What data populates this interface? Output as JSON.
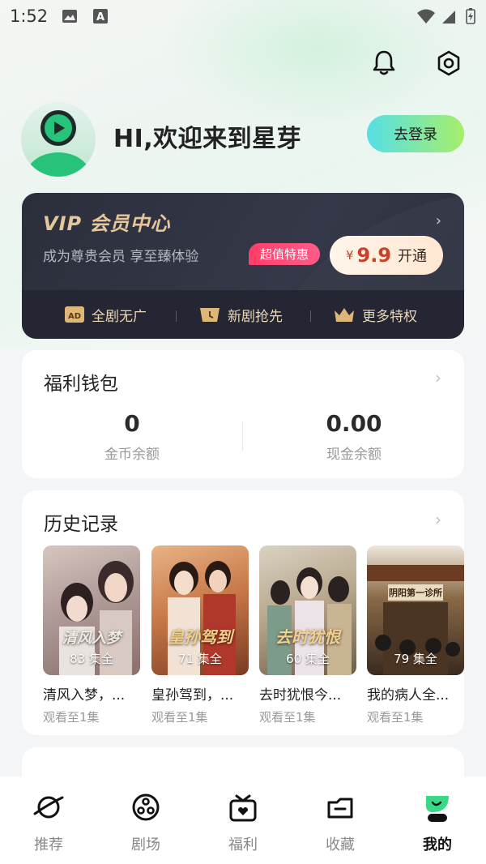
{
  "status_bar": {
    "time": "1:52"
  },
  "header": {
    "greeting": "HI,欢迎来到星芽",
    "login_label": "去登录"
  },
  "vip": {
    "title": "VIP 会员中心",
    "subtitle": "成为尊贵会员 享至臻体验",
    "badge": "超值特惠",
    "price_currency": "¥",
    "price": "9.9",
    "price_action": "开通",
    "features": [
      {
        "label": "全剧无广",
        "icon": "ad-free-icon"
      },
      {
        "label": "新剧抢先",
        "icon": "clock-icon"
      },
      {
        "label": "更多特权",
        "icon": "crown-icon"
      }
    ],
    "colors": {
      "card": "#2b2e3b",
      "gold": "#e6c79c",
      "badge": "#ff3d68"
    }
  },
  "wallet": {
    "title": "福利钱包",
    "coins_value": "0",
    "coins_label": "金币余额",
    "cash_value": "0.00",
    "cash_label": "现金余额"
  },
  "history": {
    "title": "历史记录",
    "items": [
      {
        "title": "清风入梦，...",
        "episodes": "83 集全",
        "progress": "观看至1集",
        "poster_text": "清风入梦"
      },
      {
        "title": "皇孙驾到，...",
        "episodes": "71 集全",
        "progress": "观看至1集",
        "poster_text": "皇孙驾到"
      },
      {
        "title": "去时犹恨今...",
        "episodes": "60 集全",
        "progress": "观看至1集",
        "poster_text": "去时犹恨"
      },
      {
        "title": "我的病人全...",
        "episodes": "79 集全",
        "progress": "观看至1集",
        "poster_text": "阴阳第一诊所"
      }
    ]
  },
  "tabbar": {
    "tabs": [
      {
        "label": "推荐",
        "icon": "planet-icon",
        "active": false
      },
      {
        "label": "剧场",
        "icon": "film-reel-icon",
        "active": false
      },
      {
        "label": "福利",
        "icon": "gift-icon",
        "active": false
      },
      {
        "label": "收藏",
        "icon": "folder-icon",
        "active": false
      },
      {
        "label": "我的",
        "icon": "profile-icon",
        "active": true
      }
    ]
  },
  "colors": {
    "accent_start": "#55dfe6",
    "accent_end": "#a7ee6a",
    "background": "#f4f5f6"
  }
}
